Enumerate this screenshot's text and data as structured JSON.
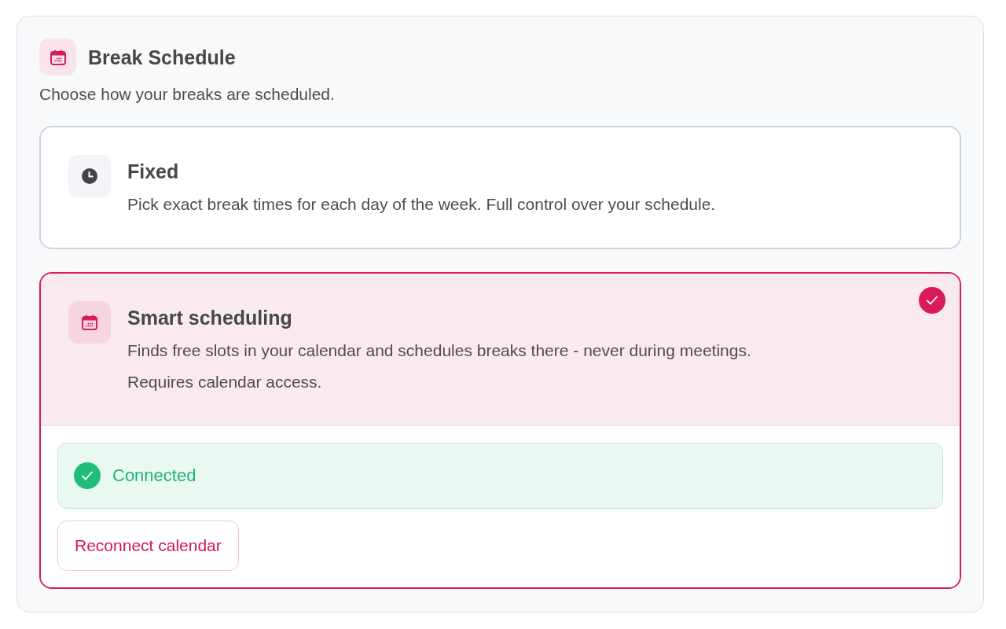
{
  "section": {
    "title": "Break Schedule",
    "subtitle": "Choose how your breaks are scheduled."
  },
  "options": [
    {
      "kind": "fixed",
      "title": "Fixed",
      "description": [
        "Pick exact break times for each day of the week. Full control over your schedule."
      ],
      "selected": false
    },
    {
      "kind": "smart",
      "title": "Smart scheduling",
      "description": [
        "Finds free slots in your calendar and schedules breaks there - never during meetings.",
        "Requires calendar access."
      ],
      "selected": true,
      "connection": {
        "status": "Connected",
        "connected": true
      },
      "action_button": "Reconnect calendar"
    }
  ]
}
